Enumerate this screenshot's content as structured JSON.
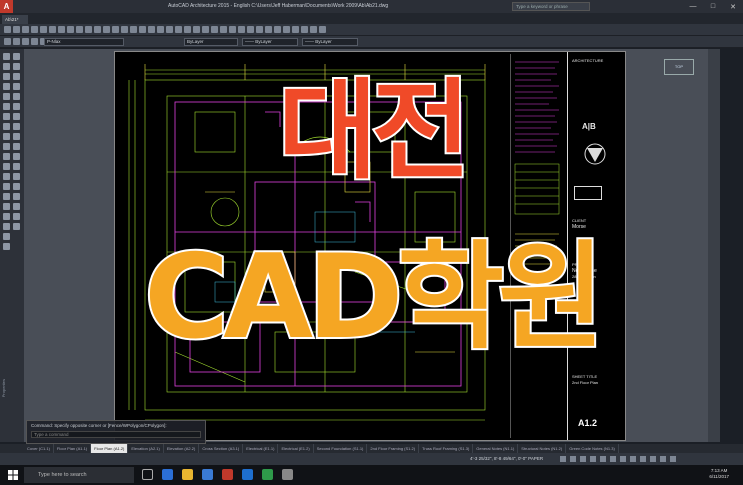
{
  "window": {
    "app_logo": "A",
    "title": "AutoCAD Architecture 2015 - English   C:\\Users\\Jeff Haberman\\Documents\\Work 2009\\Ab\\Ab21.dwg",
    "search_placeholder": "Type a keyword or phrase",
    "minimize": "—",
    "maximize": "□",
    "close": "✕"
  },
  "doc_tab": {
    "label": "Ab\\21*"
  },
  "toolbar": {
    "layer_value": "P-Nlax",
    "color_value": "ByLayer",
    "linetype_value": "—— ByLayer",
    "lineweight_value": "—— ByLayer"
  },
  "sidebar": {
    "palette_label": "Properties"
  },
  "sheet": {
    "firm_line1": "ARCHITECTURE",
    "logo_text": "A|B",
    "client_label": "CLIENT",
    "client_name": "Morse",
    "project_label": "PROJECT",
    "project_line1": "New Home",
    "project_line2": "2850 Via Fon",
    "sheet_title_label": "SHEET TITLE",
    "sheet_title": "2nd Floor Plan",
    "sheet_number": "A1.2"
  },
  "command": {
    "history": "Command: Specify opposite corner or [Fence/WPolygon/CPolygon]:",
    "prompt_placeholder": "Type a command"
  },
  "layout_tabs": [
    "Cover (C1.1)",
    "Floor Plan (A1.1)",
    "Floor Plan (A1.2)",
    "Elevation (A2.1)",
    "Elevation (A2.2)",
    "Cross Section (A3.1)",
    "Electrical (E1.1)",
    "Electrical (E1.2)",
    "Second Foundation (S1.1)",
    "2nd Floor Framing (S1.2)",
    "Truss Roof Framing (S1.3)",
    "General Notes (N1.1)",
    "Structural Notes (N1.2)",
    "Green Code Notes (N1.3)"
  ],
  "status": {
    "coordinates": "4'-3 25/32\", 8'-8 49/64\", 0'-0\"   PAPER"
  },
  "taskbar": {
    "search_text": "Type here to search",
    "time": "7:13 AM",
    "date": "6/11/2017"
  },
  "overlay": {
    "line1": "대전",
    "line2": "CAD학원",
    "color1": "#f04a28",
    "color2": "#f5a623"
  },
  "colors": {
    "plan_green": "#a4e030",
    "plan_magenta": "#e040e0",
    "plan_yellow": "#e8e040"
  }
}
